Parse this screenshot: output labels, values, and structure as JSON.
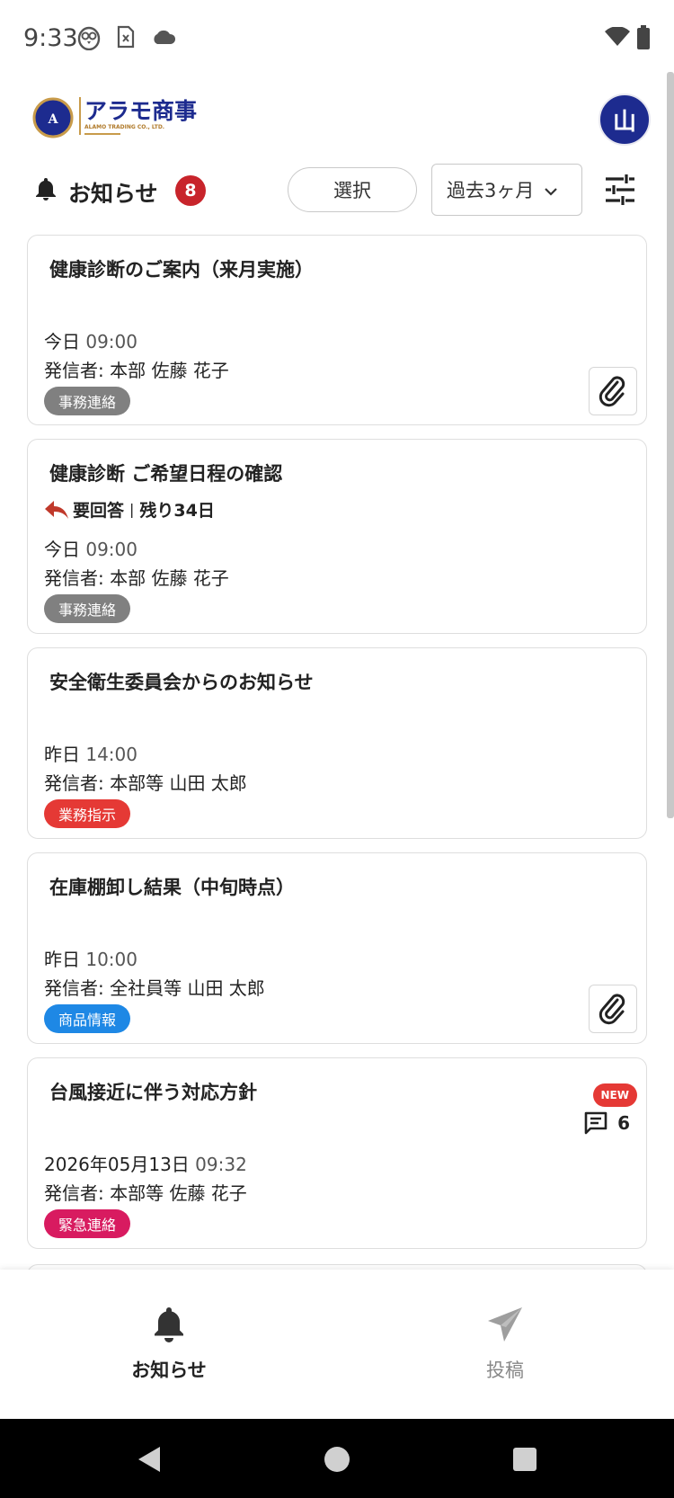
{
  "status_bar": {
    "time": "9:33"
  },
  "header": {
    "logo_letter": "A",
    "logo_name": "アラモ商事",
    "logo_sub": "ALAMO TRADING CO., LTD.",
    "avatar_initial": "山"
  },
  "toolbar": {
    "title": "お知らせ",
    "unread_count": "8",
    "select_label": "選択",
    "period_value": "過去3ヶ月"
  },
  "notices": [
    {
      "title": "健康診断のご案内（来月実施）",
      "date_label": "今日",
      "time": "09:00",
      "sender": "発信者: 本部 佐藤 花子",
      "category": "事務連絡",
      "category_color": "#808080",
      "has_attachment": true
    },
    {
      "title": "健康診断 ご希望日程の確認",
      "reply_required": "要回答",
      "reply_sep": "|",
      "remaining": "残り34日",
      "date_label": "今日",
      "time": "09:00",
      "sender": "発信者: 本部 佐藤 花子",
      "category": "事務連絡",
      "category_color": "#808080"
    },
    {
      "title": "安全衛生委員会からのお知らせ",
      "date_label": "昨日",
      "time": "14:00",
      "sender": "発信者: 本部等 山田 太郎",
      "category": "業務指示",
      "category_color": "#e53935"
    },
    {
      "title": "在庫棚卸し結果（中旬時点）",
      "date_label": "昨日",
      "time": "10:00",
      "sender": "発信者: 全社員等 山田 太郎",
      "category": "商品情報",
      "category_color": "#1e88e5",
      "has_attachment": true
    },
    {
      "title": "台風接近に伴う対応方針",
      "date_label": "2026年05月13日",
      "time": "09:32",
      "sender": "発信者: 本部等 佐藤 花子",
      "category": "緊急連絡",
      "category_color": "#d81b60",
      "new_label": "NEW",
      "comment_count": "6"
    }
  ],
  "bottom_nav": {
    "notices_label": "お知らせ",
    "post_label": "投稿"
  },
  "colors": {
    "brand_navy": "#1d2b8f",
    "badge_red": "#c8242b",
    "reply_red": "#c0392b"
  }
}
